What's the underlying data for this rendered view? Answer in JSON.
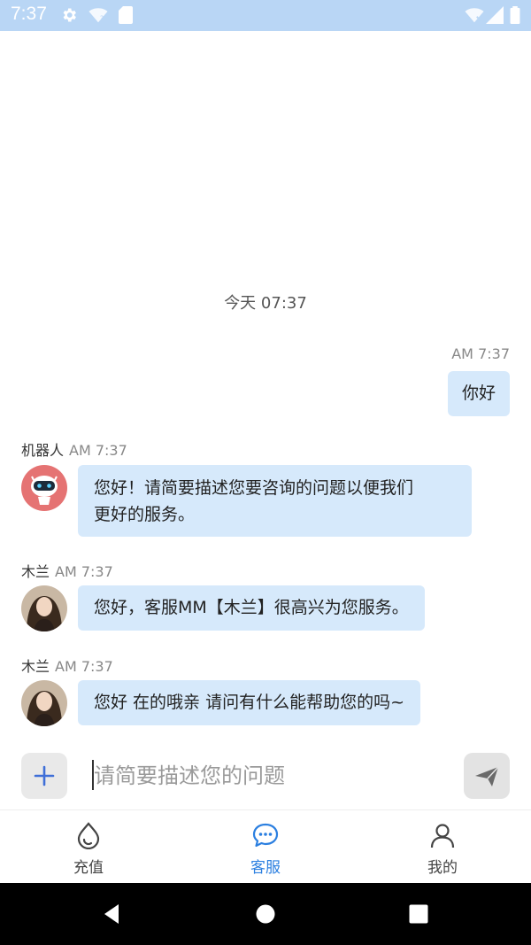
{
  "status_bar": {
    "time": "7:37",
    "icons": [
      "gear-icon",
      "wifi-question-icon",
      "sd-card-icon",
      "wifi-off-icon",
      "cell-signal-icon",
      "battery-icon"
    ]
  },
  "chat": {
    "date_separator": "今天 07:37",
    "messages": [
      {
        "side": "right",
        "time": "AM 7:37",
        "text": "你好"
      },
      {
        "side": "left",
        "sender": "机器人",
        "time": "AM 7:37",
        "text_line1": "您好！请简要描述您要咨询的问题以便我们",
        "text_line2": "更好的服务。",
        "avatar": "robot-avatar"
      },
      {
        "side": "left",
        "sender": "木兰",
        "time": "AM 7:37",
        "text": "您好，客服MM【木兰】很高兴为您服务。",
        "avatar": "agent-avatar"
      },
      {
        "side": "left",
        "sender": "木兰",
        "time": "AM 7:37",
        "text": "您好 在的哦亲 请问有什么能帮助您的吗~",
        "avatar": "agent-avatar"
      }
    ]
  },
  "input_bar": {
    "placeholder": "请简要描述您的问题",
    "value": ""
  },
  "tabs": [
    {
      "label": "充值",
      "icon": "recharge-icon",
      "active": false
    },
    {
      "label": "客服",
      "icon": "customer-service-icon",
      "active": true
    },
    {
      "label": "我的",
      "icon": "profile-icon",
      "active": false
    }
  ],
  "colors": {
    "status_bar_bg": "#b9d6f5",
    "bubble_bg": "#d6e9fb",
    "accent": "#2b7fe0",
    "robot_avatar_bg": "#e57373"
  }
}
